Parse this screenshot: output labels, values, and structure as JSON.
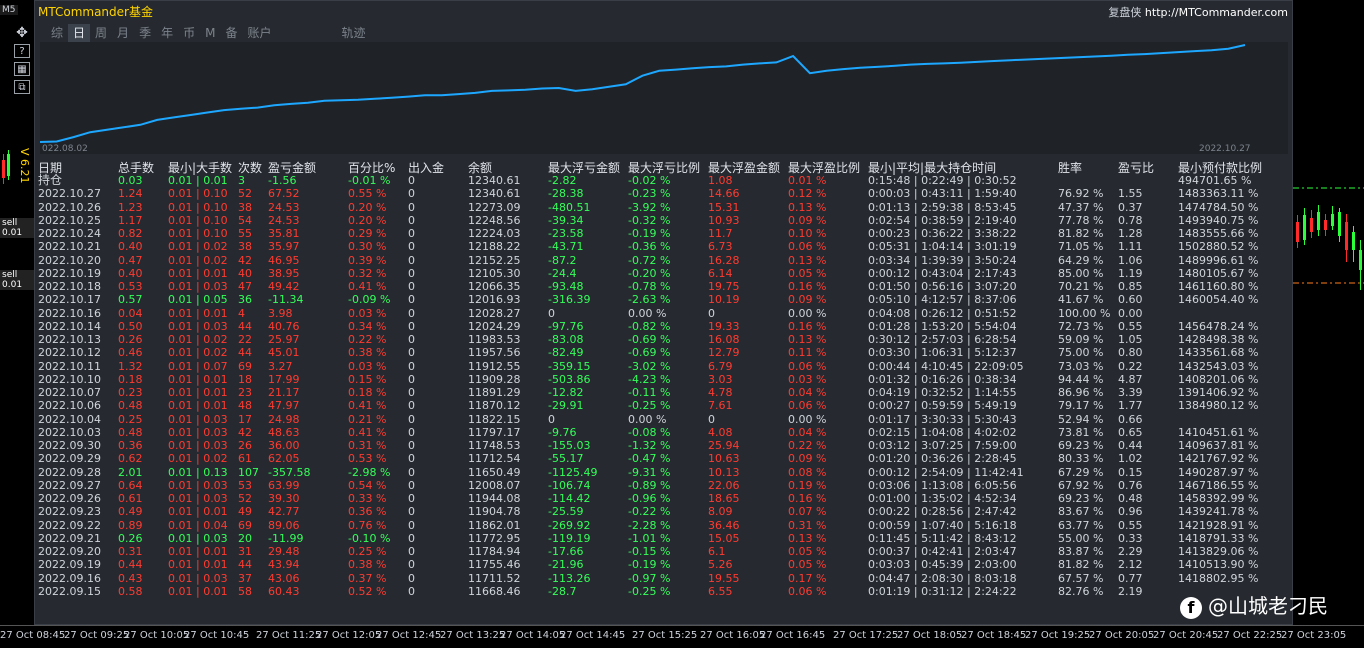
{
  "top_left_tag": "M5",
  "vertical_badge": "V 6.21",
  "sell_tags": [
    "sell 0.01",
    "sell 0.01"
  ],
  "brand_title": "MTCommander基金",
  "site_label": "复盘侠",
  "site_url": "http://MTCommander.com",
  "tabs": [
    "综",
    "日",
    "周",
    "月",
    "季",
    "年",
    "币",
    "M",
    "备",
    "账户",
    "轨迹"
  ],
  "active_tab": "日",
  "equity_chart": {
    "date_start": "022.08.02",
    "date_end": "2022.10.27",
    "line_color": "#1ea7ff",
    "values": [
      0,
      0.2,
      2,
      4,
      5,
      6,
      7,
      9,
      10,
      11,
      12,
      13,
      13.5,
      14,
      15,
      15.5,
      16,
      16.8,
      17,
      17.2,
      17.6,
      18,
      18.5,
      19,
      19,
      19.5,
      20,
      20.8,
      21,
      21.3,
      21.8,
      22,
      20.8,
      21.5,
      22.5,
      23.5,
      27,
      29,
      29.5,
      30,
      30.5,
      30.8,
      31.5,
      32,
      32.4,
      35,
      28,
      29,
      29.7,
      30.2,
      30.6,
      31,
      31.5,
      31.8,
      32,
      32.3,
      32.6,
      33,
      33.3,
      33.6,
      33.9,
      34.2,
      34.5,
      34.8,
      35.1,
      35.5,
      35.8,
      36.2,
      36.6,
      37,
      37.4,
      38,
      39.5
    ]
  },
  "columns": [
    "日期",
    "总手数",
    "最小|大手数",
    "次数",
    "盈亏金额",
    "百分比%",
    "出入金",
    "余额",
    "最大浮亏金额",
    "最大浮亏比例",
    "最大浮盈金额",
    "最大浮盈比例",
    "最小|平均|最大持仓时间",
    "胜率",
    "盈亏比",
    "最小预付款比例"
  ],
  "holding_row": [
    "持仓",
    "0.03",
    "0.01 | 0.01",
    "3",
    "-1.56",
    "-0.01 %",
    "0",
    "12340.61",
    "-2.82",
    "-0.02 %",
    "1.08",
    "0.01 %",
    "0:15:48 | 0:22:49 | 0:30:52",
    "",
    "",
    "494701.65 %"
  ],
  "rows": [
    [
      "2022.10.27",
      "1.24",
      "0.01 | 0.10",
      "52",
      "67.52",
      "0.55 %",
      "0",
      "12340.61",
      "-28.38",
      "-0.23 %",
      "14.66",
      "0.12 %",
      "0:00:03 | 0:43:11 | 1:59:40",
      "76.92 %",
      "1.55",
      "1483363.11 %"
    ],
    [
      "2022.10.26",
      "1.23",
      "0.01 | 0.10",
      "38",
      "24.53",
      "0.20 %",
      "0",
      "12273.09",
      "-480.51",
      "-3.92 %",
      "15.31",
      "0.13 %",
      "0:01:13 | 2:59:38 | 8:53:45",
      "47.37 %",
      "0.37",
      "1474784.50 %"
    ],
    [
      "2022.10.25",
      "1.17",
      "0.01 | 0.10",
      "54",
      "24.53",
      "0.20 %",
      "0",
      "12248.56",
      "-39.34",
      "-0.32 %",
      "10.93",
      "0.09 %",
      "0:02:54 | 0:38:59 | 2:19:40",
      "77.78 %",
      "0.78",
      "1493940.75 %"
    ],
    [
      "2022.10.24",
      "0.82",
      "0.01 | 0.10",
      "55",
      "35.81",
      "0.29 %",
      "0",
      "12224.03",
      "-23.58",
      "-0.19 %",
      "11.7",
      "0.10 %",
      "0:00:23 | 0:36:22 | 3:38:22",
      "81.82 %",
      "1.28",
      "1483555.66 %"
    ],
    [
      "2022.10.21",
      "0.40",
      "0.01 | 0.02",
      "38",
      "35.97",
      "0.30 %",
      "0",
      "12188.22",
      "-43.71",
      "-0.36 %",
      "6.73",
      "0.06 %",
      "0:05:31 | 1:04:14 | 3:01:19",
      "71.05 %",
      "1.11",
      "1502880.52 %"
    ],
    [
      "2022.10.20",
      "0.47",
      "0.01 | 0.02",
      "42",
      "46.95",
      "0.39 %",
      "0",
      "12152.25",
      "-87.2",
      "-0.72 %",
      "16.28",
      "0.13 %",
      "0:03:34 | 1:39:39 | 3:50:24",
      "64.29 %",
      "1.06",
      "1489996.61 %"
    ],
    [
      "2022.10.19",
      "0.40",
      "0.01 | 0.01",
      "40",
      "38.95",
      "0.32 %",
      "0",
      "12105.30",
      "-24.4",
      "-0.20 %",
      "6.14",
      "0.05 %",
      "0:00:12 | 0:43:04 | 2:17:43",
      "85.00 %",
      "1.19",
      "1480105.67 %"
    ],
    [
      "2022.10.18",
      "0.53",
      "0.01 | 0.03",
      "47",
      "49.42",
      "0.41 %",
      "0",
      "12066.35",
      "-93.48",
      "-0.78 %",
      "19.75",
      "0.16 %",
      "0:01:50 | 0:56:16 | 3:07:20",
      "70.21 %",
      "0.85",
      "1461160.80 %"
    ],
    [
      "2022.10.17",
      "0.57",
      "0.01 | 0.05",
      "36",
      "-11.34",
      "-0.09 %",
      "0",
      "12016.93",
      "-316.39",
      "-2.63 %",
      "10.19",
      "0.09 %",
      "0:05:10 | 4:12:57 | 8:37:06",
      "41.67 %",
      "0.60",
      "1460054.40 %"
    ],
    [
      "2022.10.16",
      "0.04",
      "0.01 | 0.01",
      "4",
      "3.98",
      "0.03 %",
      "0",
      "12028.27",
      "0",
      "0.00 %",
      "0",
      "0.00 %",
      "0:04:08 | 0:26:12 | 0:51:52",
      "100.00 %",
      "0.00",
      ""
    ],
    [
      "2022.10.14",
      "0.50",
      "0.01 | 0.03",
      "44",
      "40.76",
      "0.34 %",
      "0",
      "12024.29",
      "-97.76",
      "-0.82 %",
      "19.33",
      "0.16 %",
      "0:01:28 | 1:53:20 | 5:54:04",
      "72.73 %",
      "0.55",
      "1456478.24 %"
    ],
    [
      "2022.10.13",
      "0.26",
      "0.01 | 0.02",
      "22",
      "25.97",
      "0.22 %",
      "0",
      "11983.53",
      "-83.08",
      "-0.69 %",
      "16.08",
      "0.13 %",
      "0:30:12 | 2:57:03 | 6:28:54",
      "59.09 %",
      "1.05",
      "1428498.38 %"
    ],
    [
      "2022.10.12",
      "0.46",
      "0.01 | 0.02",
      "44",
      "45.01",
      "0.38 %",
      "0",
      "11957.56",
      "-82.49",
      "-0.69 %",
      "12.79",
      "0.11 %",
      "0:03:30 | 1:06:31 | 5:12:37",
      "75.00 %",
      "0.80",
      "1433561.68 %"
    ],
    [
      "2022.10.11",
      "1.32",
      "0.01 | 0.07",
      "69",
      "3.27",
      "0.03 %",
      "0",
      "11912.55",
      "-359.15",
      "-3.02 %",
      "6.79",
      "0.06 %",
      "0:00:44 | 4:10:45 | 22:09:05",
      "73.03 %",
      "0.22",
      "1432543.03 %"
    ],
    [
      "2022.10.10",
      "0.18",
      "0.01 | 0.01",
      "18",
      "17.99",
      "0.15 %",
      "0",
      "11909.28",
      "-503.86",
      "-4.23 %",
      "3.03",
      "0.03 %",
      "0:01:32 | 0:16:26 | 0:38:34",
      "94.44 %",
      "4.87",
      "1408201.06 %"
    ],
    [
      "2022.10.07",
      "0.23",
      "0.01 | 0.01",
      "23",
      "21.17",
      "0.18 %",
      "0",
      "11891.29",
      "-12.82",
      "-0.11 %",
      "4.78",
      "0.04 %",
      "0:04:19 | 0:32:52 | 1:14:55",
      "86.96 %",
      "3.39",
      "1391406.92 %"
    ],
    [
      "2022.10.06",
      "0.48",
      "0.01 | 0.01",
      "48",
      "47.97",
      "0.41 %",
      "0",
      "11870.12",
      "-29.91",
      "-0.25 %",
      "7.61",
      "0.06 %",
      "0:00:27 | 0:59:59 | 5:49:19",
      "79.17 %",
      "1.77",
      "1384980.12 %"
    ],
    [
      "2022.10.04",
      "0.25",
      "0.01 | 0.03",
      "17",
      "24.98",
      "0.21 %",
      "0",
      "11822.15",
      "0",
      "0.00 %",
      "0",
      "0.00 %",
      "0:01:17 | 3:30:33 | 5:30:43",
      "52.94 %",
      "0.66",
      ""
    ],
    [
      "2022.10.03",
      "0.48",
      "0.01 | 0.03",
      "42",
      "48.63",
      "0.41 %",
      "0",
      "11797.17",
      "-9.76",
      "-0.08 %",
      "4.08",
      "0.04 %",
      "0:02:15 | 1:04:08 | 4:02:02",
      "73.81 %",
      "0.65",
      "1410451.61 %"
    ],
    [
      "2022.09.30",
      "0.36",
      "0.01 | 0.03",
      "26",
      "36.00",
      "0.31 %",
      "0",
      "11748.53",
      "-155.03",
      "-1.32 %",
      "25.94",
      "0.22 %",
      "0:03:12 | 3:07:25 | 7:59:00",
      "69.23 %",
      "0.44",
      "1409637.81 %"
    ],
    [
      "2022.09.29",
      "0.62",
      "0.01 | 0.02",
      "61",
      "62.05",
      "0.53 %",
      "0",
      "11712.54",
      "-55.17",
      "-0.47 %",
      "10.63",
      "0.09 %",
      "0:01:20 | 0:36:26 | 2:28:45",
      "80.33 %",
      "1.02",
      "1421767.92 %"
    ],
    [
      "2022.09.28",
      "2.01",
      "0.01 | 0.13",
      "107",
      "-357.58",
      "-2.98 %",
      "0",
      "11650.49",
      "-1125.49",
      "-9.31 %",
      "10.13",
      "0.08 %",
      "0:00:12 | 2:54:09 | 11:42:41",
      "67.29 %",
      "0.15",
      "1490287.97 %"
    ],
    [
      "2022.09.27",
      "0.64",
      "0.01 | 0.03",
      "53",
      "63.99",
      "0.54 %",
      "0",
      "12008.07",
      "-106.74",
      "-0.89 %",
      "22.06",
      "0.19 %",
      "0:03:06 | 1:13:08 | 6:05:56",
      "67.92 %",
      "0.76",
      "1467186.55 %"
    ],
    [
      "2022.09.26",
      "0.61",
      "0.01 | 0.03",
      "52",
      "39.30",
      "0.33 %",
      "0",
      "11944.08",
      "-114.42",
      "-0.96 %",
      "18.65",
      "0.16 %",
      "0:01:00 | 1:35:02 | 4:52:34",
      "69.23 %",
      "0.48",
      "1458392.99 %"
    ],
    [
      "2022.09.23",
      "0.49",
      "0.01 | 0.01",
      "49",
      "42.77",
      "0.36 %",
      "0",
      "11904.78",
      "-25.59",
      "-0.22 %",
      "8.09",
      "0.07 %",
      "0:00:22 | 0:28:56 | 2:47:42",
      "83.67 %",
      "0.96",
      "1439241.78 %"
    ],
    [
      "2022.09.22",
      "0.89",
      "0.01 | 0.04",
      "69",
      "89.06",
      "0.76 %",
      "0",
      "11862.01",
      "-269.92",
      "-2.28 %",
      "36.46",
      "0.31 %",
      "0:00:59 | 1:07:40 | 5:16:18",
      "63.77 %",
      "0.55",
      "1421928.91 %"
    ],
    [
      "2022.09.21",
      "0.26",
      "0.01 | 0.03",
      "20",
      "-11.99",
      "-0.10 %",
      "0",
      "11772.95",
      "-119.19",
      "-1.01 %",
      "15.05",
      "0.13 %",
      "0:11:45 | 5:11:42 | 8:43:12",
      "55.00 %",
      "0.33",
      "1418791.33 %"
    ],
    [
      "2022.09.20",
      "0.31",
      "0.01 | 0.01",
      "31",
      "29.48",
      "0.25 %",
      "0",
      "11784.94",
      "-17.66",
      "-0.15 %",
      "6.1",
      "0.05 %",
      "0:00:37 | 0:42:41 | 2:03:47",
      "83.87 %",
      "2.29",
      "1413829.06 %"
    ],
    [
      "2022.09.19",
      "0.44",
      "0.01 | 0.01",
      "44",
      "43.94",
      "0.38 %",
      "0",
      "11755.46",
      "-21.96",
      "-0.19 %",
      "5.26",
      "0.05 %",
      "0:03:03 | 0:45:39 | 2:03:00",
      "81.82 %",
      "2.12",
      "1410513.90 %"
    ],
    [
      "2022.09.16",
      "0.43",
      "0.01 | 0.03",
      "37",
      "43.06",
      "0.37 %",
      "0",
      "11711.52",
      "-113.26",
      "-0.97 %",
      "19.55",
      "0.17 %",
      "0:04:47 | 2:08:30 | 8:03:18",
      "67.57 %",
      "0.77",
      "1418802.95 %"
    ],
    [
      "2022.09.15",
      "0.58",
      "0.01 | 0.01",
      "58",
      "60.43",
      "0.52 %",
      "0",
      "11668.46",
      "-28.7",
      "-0.25 %",
      "6.55",
      "0.06 %",
      "0:01:19 | 0:31:12 | 2:24:22",
      "82.76 %",
      "2.19",
      ""
    ]
  ],
  "time_axis": [
    "27 Oct 08:45",
    "27 Oct 09:25",
    "27 Oct 10:05",
    "27 Oct 10:45",
    "27 Oct 11:25",
    "27 Oct 12:05",
    "27 Oct 12:45",
    "27 Oct 13:25",
    "27 Oct 14:05",
    "27 Oct 14:45",
    "27 Oct 15:25",
    "27 Oct 16:05",
    "27 Oct 16:45",
    "27 Oct 17:25",
    "27 Oct 18:05",
    "27 Oct 18:45",
    "27 Oct 19:25",
    "27 Oct 20:05",
    "27 Oct 20:45",
    "27 Oct 22:25",
    "27 Oct 23:05"
  ],
  "watermark": "@山城老刁民",
  "colors": {
    "profit": "#ff3b30",
    "loss": "#34ff5a",
    "neutral": "#d0d4db",
    "brand": "#ffd400",
    "panel": "#262a30"
  }
}
